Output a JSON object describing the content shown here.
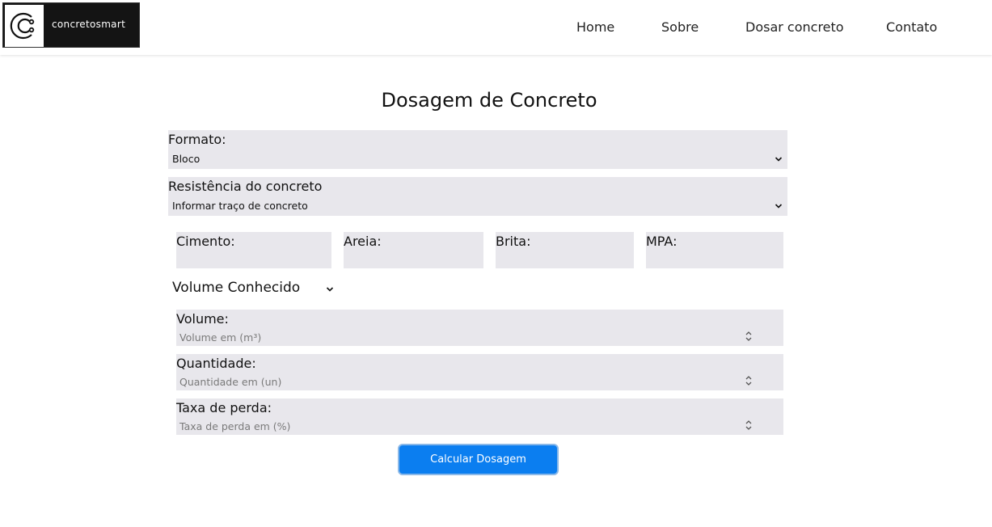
{
  "brand": {
    "name": "concretosmart"
  },
  "nav": {
    "items": [
      "Home",
      "Sobre",
      "Dosar concreto",
      "Contato"
    ]
  },
  "page": {
    "title": "Dosagem de Concreto"
  },
  "formato": {
    "label": "Formato:",
    "value": "Bloco"
  },
  "resistencia": {
    "label": "Resistência do concreto",
    "value": "Informar traço de concreto"
  },
  "traco": {
    "cimento": "Cimento:",
    "areia": "Areia:",
    "brita": "Brita:",
    "mpa": "MPA:"
  },
  "modo": {
    "value": "Volume Conhecido"
  },
  "volume": {
    "label": "Volume:",
    "placeholder": "Volume em (m³)"
  },
  "quantidade": {
    "label": "Quantidade:",
    "placeholder": "Quantidade em (un)"
  },
  "perda": {
    "label": "Taxa de perda:",
    "placeholder": "Taxa de perda em (%)"
  },
  "actions": {
    "calcular": "Calcular Dosagem"
  },
  "colors": {
    "accent": "#0b7ef0",
    "field_bg": "#e8e7ec",
    "logo_bg": "#141414"
  }
}
